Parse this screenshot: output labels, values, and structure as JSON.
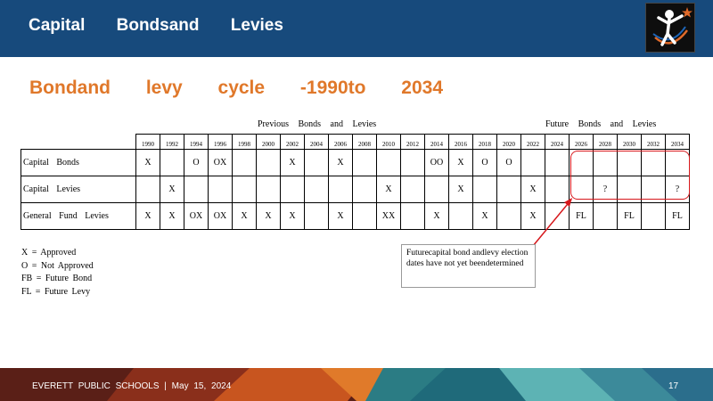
{
  "header": {
    "title": "Capital Bondsand Levies"
  },
  "subtitle": "Bondand levy cycle -1990to 2034",
  "group_labels": {
    "previous": "Previous Bonds and Levies",
    "future": "Future Bonds and Levies"
  },
  "years": [
    "1990",
    "1992",
    "1994",
    "1996",
    "1998",
    "2000",
    "2002",
    "2004",
    "2006",
    "2008",
    "2010",
    "2012",
    "2014",
    "2016",
    "2018",
    "2020",
    "2022",
    "2024",
    "2026",
    "2028",
    "2030",
    "2032",
    "2034"
  ],
  "rows": [
    {
      "label": "Capital Bonds",
      "cells": [
        "X",
        "",
        "O",
        "OX",
        "",
        "",
        "X",
        "",
        "X",
        "",
        "",
        "",
        "OO",
        "X",
        "O",
        "O",
        "",
        "",
        "",
        "",
        "",
        "",
        ""
      ]
    },
    {
      "label": "Capital Levies",
      "cells": [
        "",
        "X",
        "",
        "",
        "",
        "",
        "",
        "",
        "",
        "",
        "X",
        "",
        "",
        "X",
        "",
        "",
        "X",
        "",
        "",
        "?",
        "",
        "",
        "?"
      ]
    },
    {
      "label": "General Fund Levies",
      "cells": [
        "X",
        "X",
        "OX",
        "OX",
        "X",
        "X",
        "X",
        "",
        "X",
        "",
        "XX",
        "",
        "X",
        "",
        "X",
        "",
        "X",
        "",
        "FL",
        "",
        "FL",
        "",
        "FL"
      ]
    }
  ],
  "legend": [
    "X = Approved",
    "O = Not Approved",
    "FB = Future Bond",
    "FL = Future Levy"
  ],
  "note": "Futurecapital bond andlevy election dates have not yet beendetermined",
  "footer": {
    "text": "EVERETT PUBLIC SCHOOLS | May 15, 2024",
    "page": "17"
  },
  "colors": {
    "header_bg": "#174a7c",
    "subtitle": "#e0782a",
    "highlight": "#d6171b",
    "footer_bg": "#5a1f17"
  }
}
